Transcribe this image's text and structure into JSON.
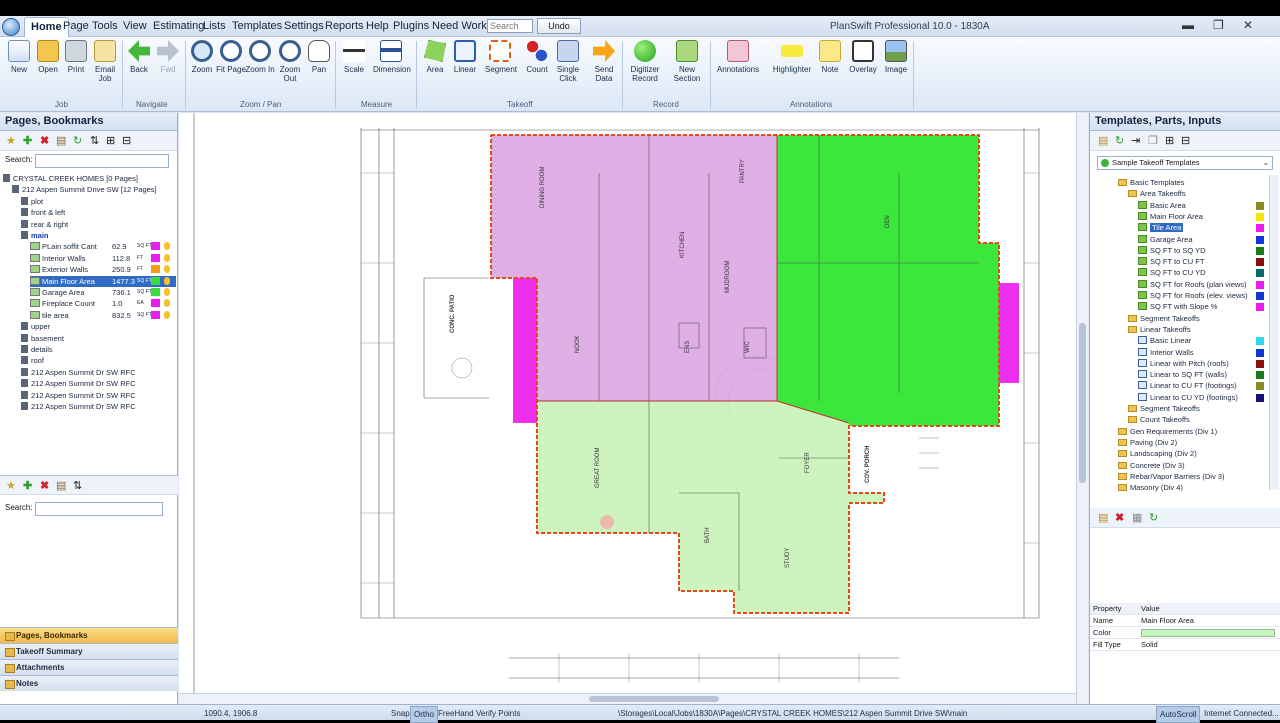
{
  "app": {
    "title": "PlanSwift Professional 10.0 - 1830A"
  },
  "menu": {
    "items": [
      "Home",
      "Page",
      "Tools",
      "View",
      "Estimating",
      "Lists",
      "Templates",
      "Settings",
      "Reports",
      "Help",
      "Plugins",
      "Need Work?"
    ],
    "search_placeholder": "Search",
    "undo_label": "Undo"
  },
  "ribbon": {
    "buttons": {
      "new": "New",
      "open": "Open",
      "print": "Print",
      "email_job": "Email Job",
      "back": "Back",
      "fwd": "Fwd",
      "zoom": "Zoom",
      "fit_page": "Fit Page",
      "zoom_in": "Zoom In",
      "zoom_out": "Zoom Out",
      "pan": "Pan",
      "scale": "Scale",
      "dimension": "Dimension",
      "area": "Area",
      "linear": "Linear",
      "segment": "Segment",
      "count": "Count",
      "single_click": "Single Click",
      "send_data": "Send Data",
      "digitizer_record": "Digitizer Record",
      "new_section": "New Section",
      "annotations": "Annotations",
      "highlighter": "Highlighter",
      "note": "Note",
      "overlay": "Overlay",
      "image": "Image"
    },
    "groups": {
      "job": "Job",
      "navigate": "Navigate",
      "zoom_pan": "Zoom / Pan",
      "measure": "Measure",
      "takeoff": "Takeoff",
      "record": "Record",
      "annotations": "Annotations"
    }
  },
  "left_panel": {
    "title": "Pages, Bookmarks",
    "search_label": "Search:",
    "tree": [
      {
        "label": "CRYSTAL CREEK HOMES [0 Pages]",
        "indent": 0
      },
      {
        "label": "212 Aspen Summit Drive SW [12 Pages]",
        "indent": 1
      },
      {
        "label": "plot",
        "indent": 2
      },
      {
        "label": "front & left",
        "indent": 2
      },
      {
        "label": "rear & right",
        "indent": 2
      },
      {
        "label": "main",
        "indent": 2,
        "bold": true
      },
      {
        "label": "PLain soffit Cant",
        "qty": "62.9",
        "unit": "SQ FT",
        "color": "#e81ef0",
        "indent": 3
      },
      {
        "label": "Interior Walls",
        "qty": "112.8",
        "unit": "FT",
        "color": "#e81ef0",
        "indent": 3
      },
      {
        "label": "Exterior Walls",
        "qty": "250.9",
        "unit": "FT",
        "color": "#f79a1b",
        "indent": 3
      },
      {
        "label": "Main Floor Area",
        "qty": "1477.3",
        "unit": "SQ FT",
        "color": "#3ddc3d",
        "indent": 3,
        "selected": true
      },
      {
        "label": "Garage Area",
        "qty": "736.1",
        "unit": "SQ FT",
        "color": "#3ddc3d",
        "indent": 3
      },
      {
        "label": "Fireplace Count",
        "qty": "1.0",
        "unit": "EA",
        "color": "#e81ef0",
        "indent": 3
      },
      {
        "label": "tile area",
        "qty": "832.5",
        "unit": "SQ FT",
        "color": "#e81ef0",
        "indent": 3
      },
      {
        "label": "upper",
        "indent": 2
      },
      {
        "label": "basement",
        "indent": 2
      },
      {
        "label": "details",
        "indent": 2
      },
      {
        "label": "roof",
        "indent": 2
      },
      {
        "label": "212 Aspen Summit Dr SW RFC",
        "indent": 2
      },
      {
        "label": "212 Aspen Summit Dr SW RFC",
        "indent": 2
      },
      {
        "label": "212 Aspen Summit Dr SW RFC",
        "indent": 2
      },
      {
        "label": "212 Aspen Summit Dr SW RFC",
        "indent": 2
      }
    ],
    "lower_search_label": "Search:",
    "accordion": [
      "Pages, Bookmarks",
      "Takeoff Summary",
      "Attachments",
      "Notes"
    ]
  },
  "right_panel": {
    "title": "Templates, Parts, Inputs",
    "dropdown": "Sample Takeoff Templates",
    "tree": [
      {
        "label": "Basic Templates",
        "type": "folder",
        "indent": 1
      },
      {
        "label": "Area Takeoffs",
        "type": "folder",
        "indent": 2
      },
      {
        "label": "Basic Area",
        "type": "item",
        "indent": 3,
        "color": "#8a8a20"
      },
      {
        "label": "Main Floor Area",
        "type": "item",
        "indent": 3,
        "color": "#f3e600"
      },
      {
        "label": "Tile Area",
        "type": "item",
        "indent": 3,
        "color": "#e81ef0",
        "selected": true
      },
      {
        "label": "Garage Area",
        "type": "item",
        "indent": 3,
        "color": "#1036d8"
      },
      {
        "label": "SQ FT to SQ YD",
        "type": "item",
        "indent": 3,
        "color": "#1a7a1a"
      },
      {
        "label": "SQ FT to CU FT",
        "type": "item",
        "indent": 3,
        "color": "#8a1010"
      },
      {
        "label": "SQ FT to CU YD",
        "type": "item",
        "indent": 3,
        "color": "#0a6a6a"
      },
      {
        "label": "SQ FT for Roofs (plan views)",
        "type": "item",
        "indent": 3,
        "color": "#e81ef0"
      },
      {
        "label": "SQ FT for Roofs (elev. views)",
        "type": "item",
        "indent": 3,
        "color": "#1036d8"
      },
      {
        "label": "SQ FT with Slope %",
        "type": "item",
        "indent": 3,
        "color": "#e81ef0"
      },
      {
        "label": "Segment Takeoffs",
        "type": "folder",
        "indent": 2
      },
      {
        "label": "Linear Takeoffs",
        "type": "folder",
        "indent": 2
      },
      {
        "label": "Basic Linear",
        "type": "line",
        "indent": 3,
        "color": "#32d8f0"
      },
      {
        "label": "Interior Walls",
        "type": "line",
        "indent": 3,
        "color": "#1036d8"
      },
      {
        "label": "Linear with Pitch (roofs)",
        "type": "line",
        "indent": 3,
        "color": "#8a1010"
      },
      {
        "label": "Linear to SQ FT (walls)",
        "type": "line",
        "indent": 3,
        "color": "#1a7a1a"
      },
      {
        "label": "Linear to CU FT (footings)",
        "type": "line",
        "indent": 3,
        "color": "#8a8a20"
      },
      {
        "label": "Linear to CU YD (footings)",
        "type": "line",
        "indent": 3,
        "color": "#12127a"
      },
      {
        "label": "Segment Takeoffs",
        "type": "folder",
        "indent": 2
      },
      {
        "label": "Count Takeoffs",
        "type": "folder",
        "indent": 2
      },
      {
        "label": "Gen Requirements (Div 1)",
        "type": "folder",
        "indent": 1
      },
      {
        "label": "Paving (Div 2)",
        "type": "folder",
        "indent": 1
      },
      {
        "label": "Landscaping (Div 2)",
        "type": "folder",
        "indent": 1
      },
      {
        "label": "Concrete (Div 3)",
        "type": "folder",
        "indent": 1
      },
      {
        "label": "Rebar/Vapor Barriers (Div 3)",
        "type": "folder",
        "indent": 1
      },
      {
        "label": "Masonry (Div 4)",
        "type": "folder",
        "indent": 1
      }
    ],
    "properties": {
      "header_property": "Property",
      "header_value": "Value",
      "rows": [
        {
          "property": "Name",
          "value": "Main Floor Area"
        },
        {
          "property": "Color",
          "value": "",
          "swatch": "#c6f5c0"
        },
        {
          "property": "Fill Type",
          "value": "Solid"
        }
      ]
    }
  },
  "plan": {
    "labels": [
      "DINING ROOM",
      "PANTRY",
      "KITCHEN",
      "GREAT ROOM",
      "DEN",
      "NOOK",
      "FOYER",
      "BATH",
      "STUDY",
      "COV. PORCH",
      "CONC. PATIO",
      "WIC",
      "MUDROOM",
      "ENS"
    ]
  },
  "status": {
    "coords": "1090.4, 1906.8",
    "snap": "Snap",
    "ortho": "Ortho",
    "freehand": "FreeHand",
    "verify": "Verify Points",
    "path": "\\Storages\\Local\\Jobs\\1830A\\Pages\\CRYSTAL CREEK HOMES\\212 Aspen Summit Drive SW\\main",
    "autoscroll": "AutoScroll",
    "connection": "Internet Connected..."
  }
}
